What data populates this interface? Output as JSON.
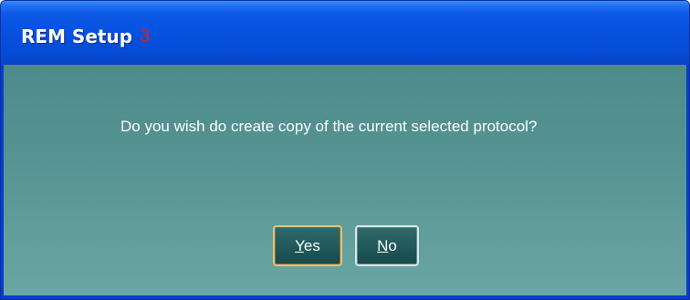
{
  "window": {
    "title": "REM Setup",
    "title_number": "3"
  },
  "dialog": {
    "message": "Do you wish do create copy of the current selected protocol?",
    "buttons": {
      "yes_mnemonic": "Y",
      "yes_rest": "es",
      "no_mnemonic": "N",
      "no_rest": "o"
    }
  },
  "colors": {
    "titlebar": "#0550df",
    "client": "#579594",
    "title_number": "#e41e1e",
    "default_button_border": "#e3c27a"
  }
}
